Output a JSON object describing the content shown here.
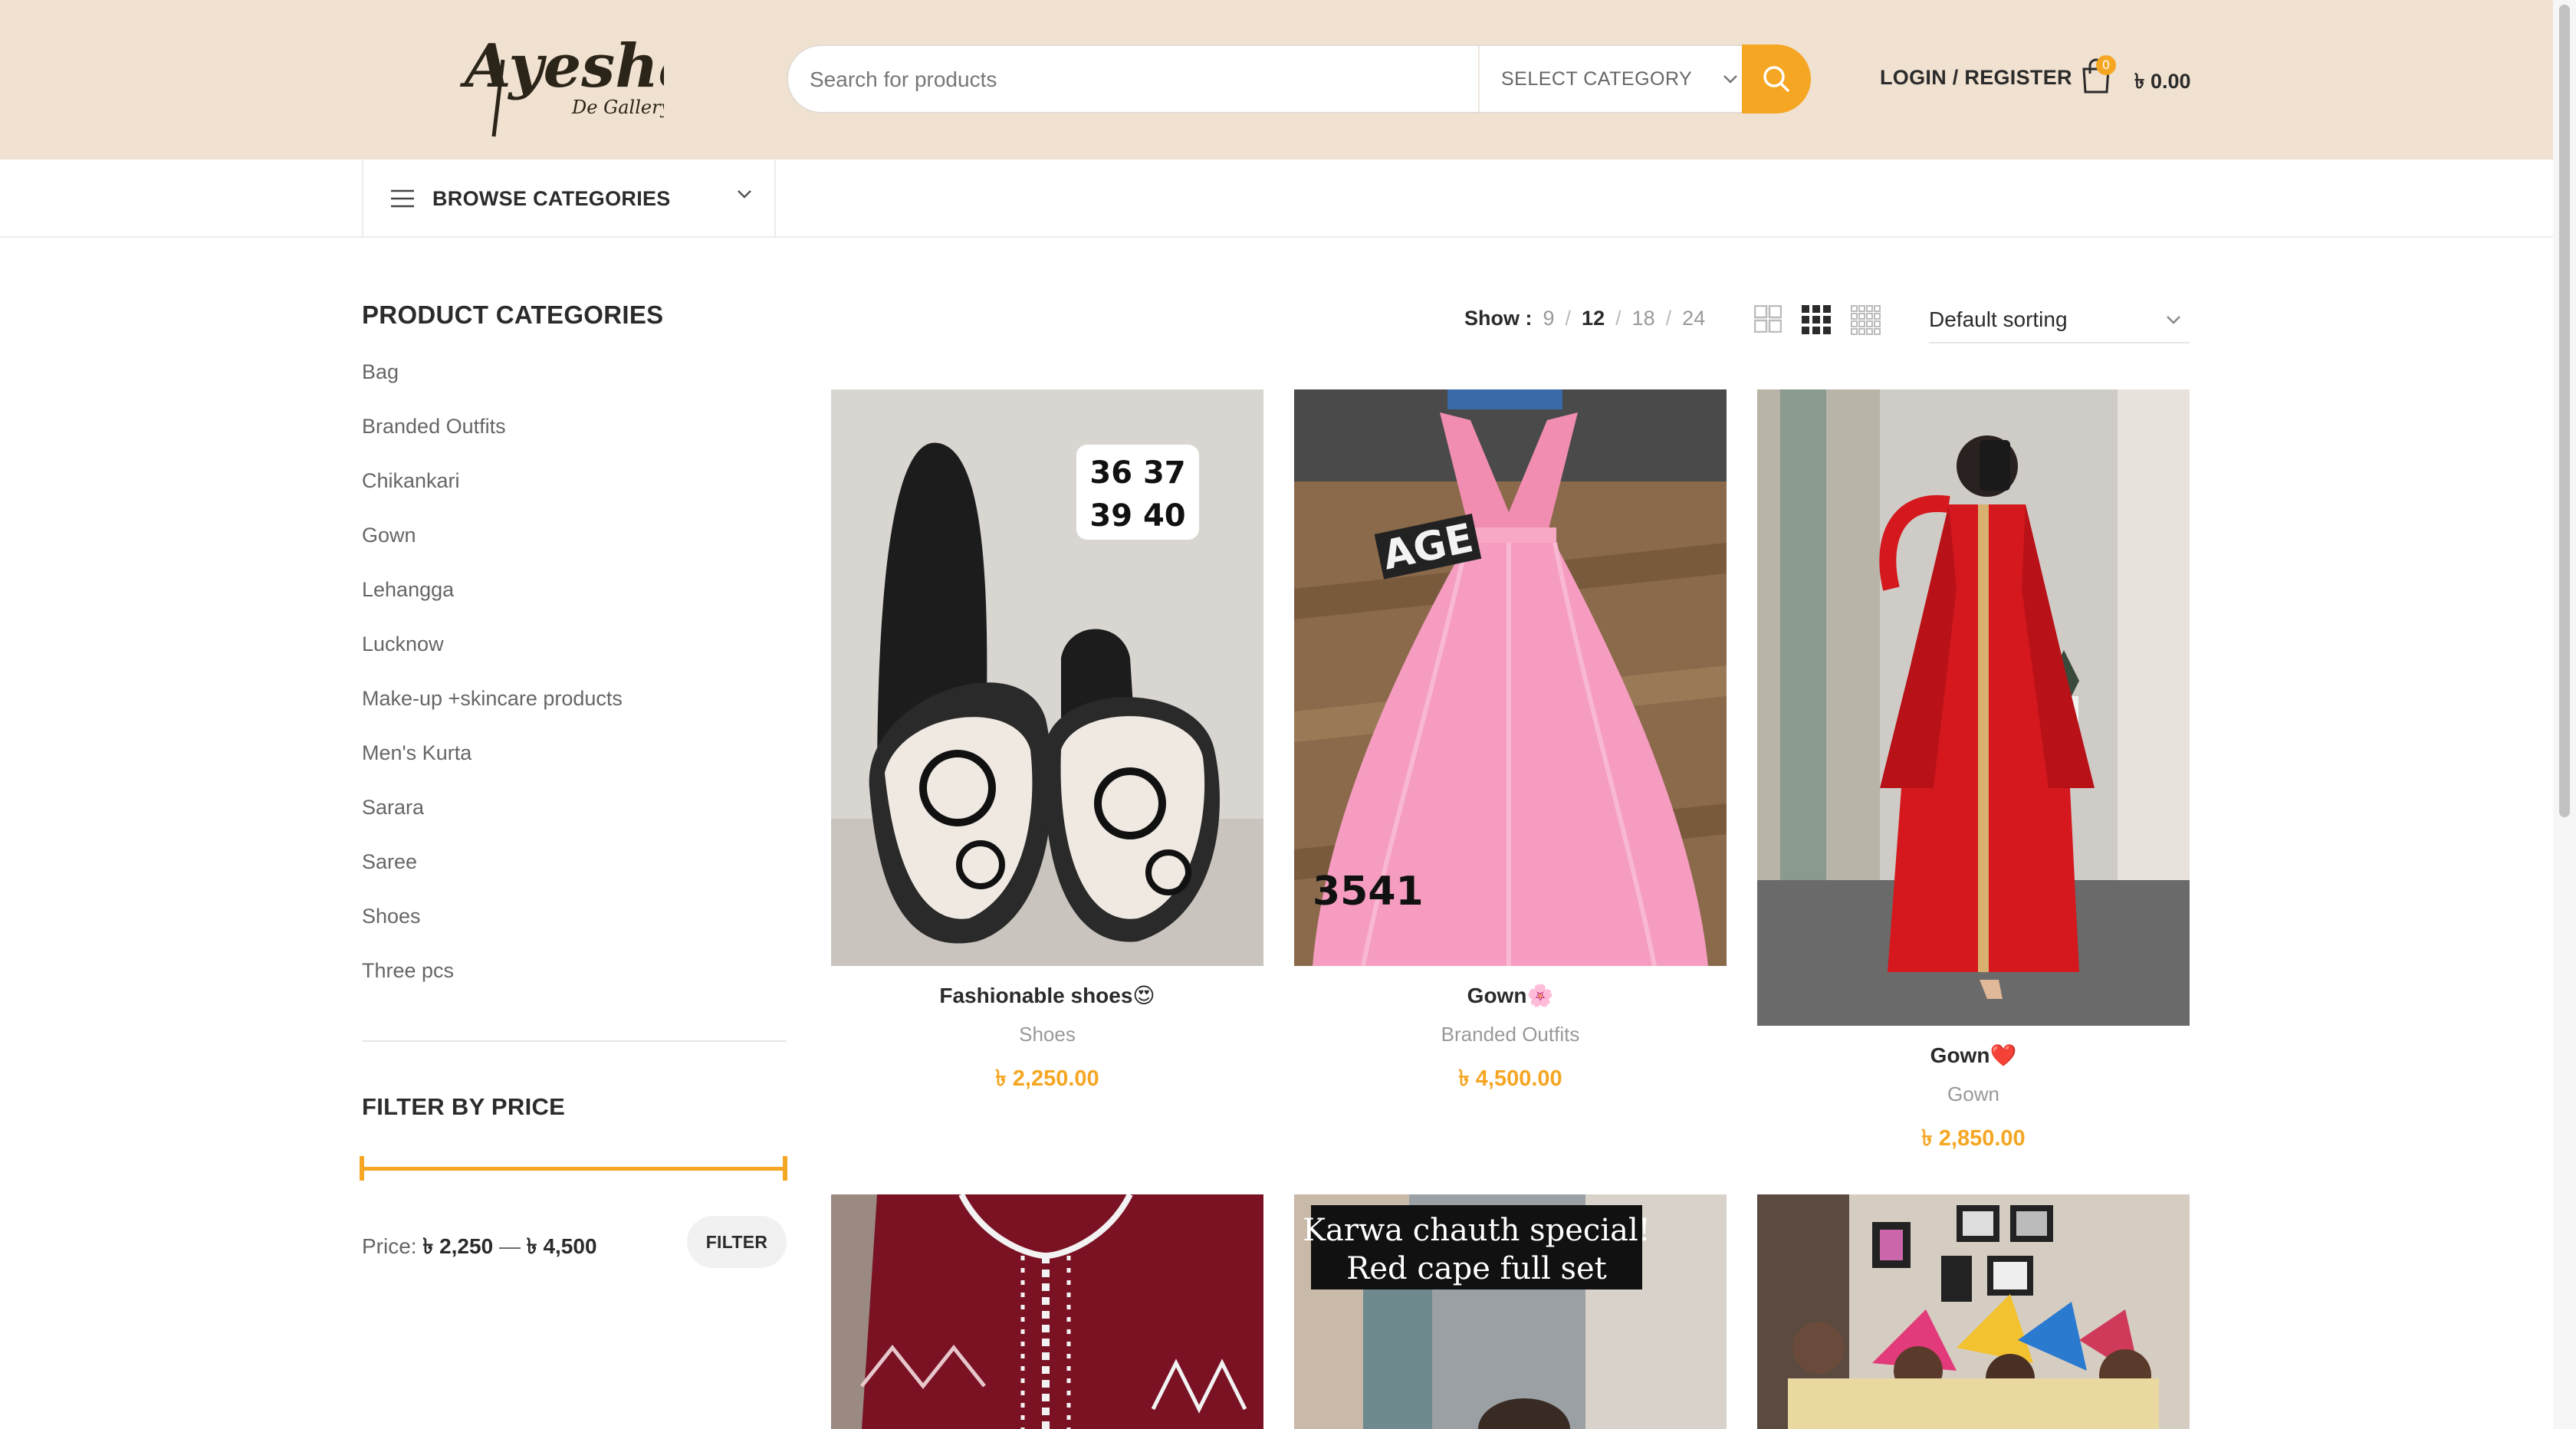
{
  "brand": {
    "logo_main": "Ayesha's",
    "logo_sub": "De Gallery"
  },
  "search": {
    "placeholder": "Search for products",
    "category_label": "SELECT CATEGORY"
  },
  "header": {
    "login_label": "LOGIN / REGISTER",
    "cart_count": "0",
    "cart_total": "৳ 0.00"
  },
  "nav": {
    "browse_label": "BROWSE CATEGORIES"
  },
  "sidebar": {
    "title": "PRODUCT CATEGORIES",
    "categories": [
      "Bag",
      "Branded Outfits",
      "Chikankari",
      "Gown",
      "Lehangga",
      "Lucknow",
      "Make-up +skincare products",
      "Men's Kurta",
      "Sarara",
      "Saree",
      "Shoes",
      "Three pcs"
    ],
    "filter_title": "FILTER BY PRICE",
    "price_prefix": "Price:",
    "price_min": "৳ 2,250",
    "price_sep": "—",
    "price_max": "৳ 4,500",
    "filter_button": "FILTER"
  },
  "toolbar": {
    "show_label": "Show :",
    "show_options": [
      "9",
      "12",
      "18",
      "24"
    ],
    "show_active": "12",
    "sort_label": "Default sorting"
  },
  "products": [
    {
      "name": "Fashionable shoes😍",
      "category": "Shoes",
      "price": "৳ 2,250.00",
      "image_text": [
        "36 37",
        "39 40"
      ]
    },
    {
      "name": "Gown🌸",
      "category": "Branded Outfits",
      "price": "৳ 4,500.00",
      "image_text": [
        "AGE",
        "3541"
      ]
    },
    {
      "name": "Gown❤️",
      "category": "Gown",
      "price": "৳ 2,850.00"
    }
  ],
  "lower_products": [
    {
      "image_text": []
    },
    {
      "image_text": [
        "Karwa chauth special!",
        "Red cape full set"
      ]
    },
    {
      "image_text": []
    }
  ],
  "colors": {
    "accent": "#f5a623",
    "header_bg": "#f0e1d0"
  }
}
